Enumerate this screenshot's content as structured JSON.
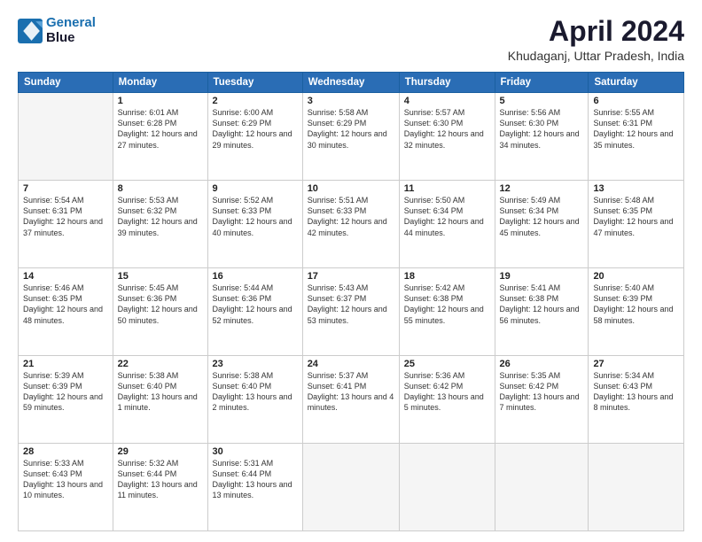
{
  "header": {
    "logo_line1": "General",
    "logo_line2": "Blue",
    "title": "April 2024",
    "subtitle": "Khudaganj, Uttar Pradesh, India"
  },
  "weekdays": [
    "Sunday",
    "Monday",
    "Tuesday",
    "Wednesday",
    "Thursday",
    "Friday",
    "Saturday"
  ],
  "weeks": [
    [
      {
        "num": "",
        "empty": true
      },
      {
        "num": "1",
        "rise": "6:01 AM",
        "set": "6:28 PM",
        "daylight": "12 hours and 27 minutes."
      },
      {
        "num": "2",
        "rise": "6:00 AM",
        "set": "6:29 PM",
        "daylight": "12 hours and 29 minutes."
      },
      {
        "num": "3",
        "rise": "5:58 AM",
        "set": "6:29 PM",
        "daylight": "12 hours and 30 minutes."
      },
      {
        "num": "4",
        "rise": "5:57 AM",
        "set": "6:30 PM",
        "daylight": "12 hours and 32 minutes."
      },
      {
        "num": "5",
        "rise": "5:56 AM",
        "set": "6:30 PM",
        "daylight": "12 hours and 34 minutes."
      },
      {
        "num": "6",
        "rise": "5:55 AM",
        "set": "6:31 PM",
        "daylight": "12 hours and 35 minutes."
      }
    ],
    [
      {
        "num": "7",
        "rise": "5:54 AM",
        "set": "6:31 PM",
        "daylight": "12 hours and 37 minutes."
      },
      {
        "num": "8",
        "rise": "5:53 AM",
        "set": "6:32 PM",
        "daylight": "12 hours and 39 minutes."
      },
      {
        "num": "9",
        "rise": "5:52 AM",
        "set": "6:33 PM",
        "daylight": "12 hours and 40 minutes."
      },
      {
        "num": "10",
        "rise": "5:51 AM",
        "set": "6:33 PM",
        "daylight": "12 hours and 42 minutes."
      },
      {
        "num": "11",
        "rise": "5:50 AM",
        "set": "6:34 PM",
        "daylight": "12 hours and 44 minutes."
      },
      {
        "num": "12",
        "rise": "5:49 AM",
        "set": "6:34 PM",
        "daylight": "12 hours and 45 minutes."
      },
      {
        "num": "13",
        "rise": "5:48 AM",
        "set": "6:35 PM",
        "daylight": "12 hours and 47 minutes."
      }
    ],
    [
      {
        "num": "14",
        "rise": "5:46 AM",
        "set": "6:35 PM",
        "daylight": "12 hours and 48 minutes."
      },
      {
        "num": "15",
        "rise": "5:45 AM",
        "set": "6:36 PM",
        "daylight": "12 hours and 50 minutes."
      },
      {
        "num": "16",
        "rise": "5:44 AM",
        "set": "6:36 PM",
        "daylight": "12 hours and 52 minutes."
      },
      {
        "num": "17",
        "rise": "5:43 AM",
        "set": "6:37 PM",
        "daylight": "12 hours and 53 minutes."
      },
      {
        "num": "18",
        "rise": "5:42 AM",
        "set": "6:38 PM",
        "daylight": "12 hours and 55 minutes."
      },
      {
        "num": "19",
        "rise": "5:41 AM",
        "set": "6:38 PM",
        "daylight": "12 hours and 56 minutes."
      },
      {
        "num": "20",
        "rise": "5:40 AM",
        "set": "6:39 PM",
        "daylight": "12 hours and 58 minutes."
      }
    ],
    [
      {
        "num": "21",
        "rise": "5:39 AM",
        "set": "6:39 PM",
        "daylight": "12 hours and 59 minutes."
      },
      {
        "num": "22",
        "rise": "5:38 AM",
        "set": "6:40 PM",
        "daylight": "13 hours and 1 minute."
      },
      {
        "num": "23",
        "rise": "5:38 AM",
        "set": "6:40 PM",
        "daylight": "13 hours and 2 minutes."
      },
      {
        "num": "24",
        "rise": "5:37 AM",
        "set": "6:41 PM",
        "daylight": "13 hours and 4 minutes."
      },
      {
        "num": "25",
        "rise": "5:36 AM",
        "set": "6:42 PM",
        "daylight": "13 hours and 5 minutes."
      },
      {
        "num": "26",
        "rise": "5:35 AM",
        "set": "6:42 PM",
        "daylight": "13 hours and 7 minutes."
      },
      {
        "num": "27",
        "rise": "5:34 AM",
        "set": "6:43 PM",
        "daylight": "13 hours and 8 minutes."
      }
    ],
    [
      {
        "num": "28",
        "rise": "5:33 AM",
        "set": "6:43 PM",
        "daylight": "13 hours and 10 minutes."
      },
      {
        "num": "29",
        "rise": "5:32 AM",
        "set": "6:44 PM",
        "daylight": "13 hours and 11 minutes."
      },
      {
        "num": "30",
        "rise": "5:31 AM",
        "set": "6:44 PM",
        "daylight": "13 hours and 13 minutes."
      },
      {
        "num": "",
        "empty": true
      },
      {
        "num": "",
        "empty": true
      },
      {
        "num": "",
        "empty": true
      },
      {
        "num": "",
        "empty": true
      }
    ]
  ]
}
